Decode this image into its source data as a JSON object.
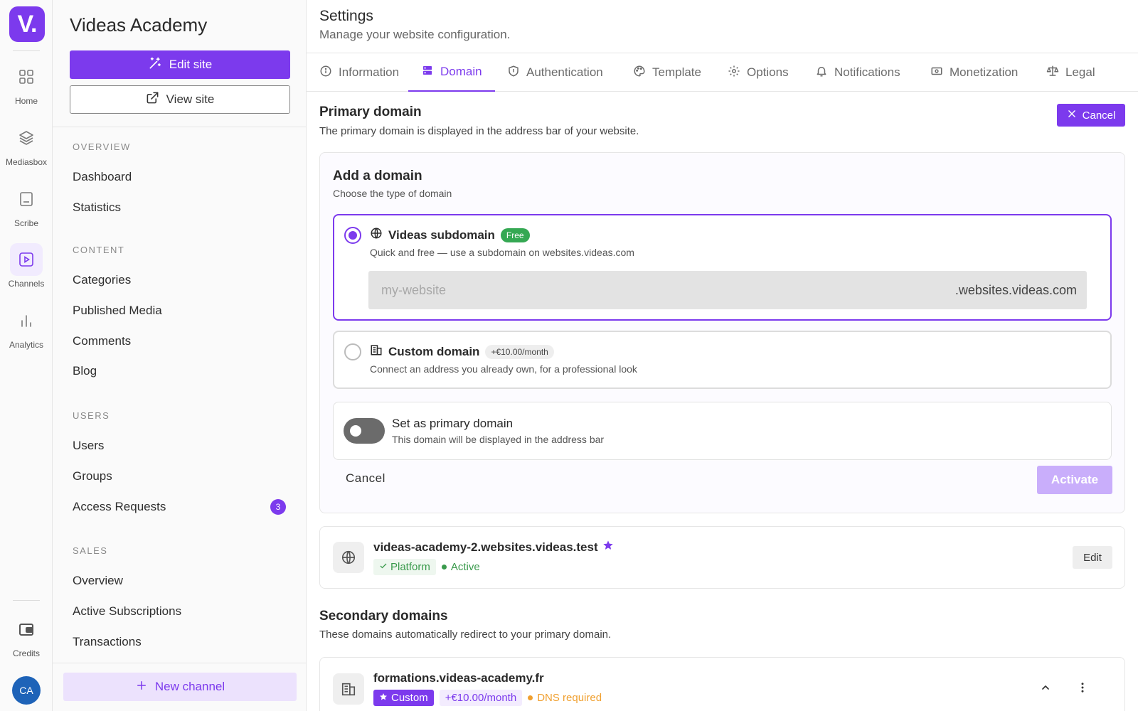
{
  "rail": {
    "logo": "V.",
    "items": [
      {
        "label": "Home",
        "icon": "grid-icon"
      },
      {
        "label": "Mediasbox",
        "icon": "layers-icon"
      },
      {
        "label": "Scribe",
        "icon": "document-icon"
      },
      {
        "label": "Channels",
        "icon": "play-icon",
        "active": true
      },
      {
        "label": "Analytics",
        "icon": "bar-chart-icon"
      }
    ],
    "credits_label": "Credits",
    "avatar_initials": "CA"
  },
  "sidebar": {
    "site_title": "Videas Academy",
    "edit_site_label": "Edit site",
    "view_site_label": "View site",
    "sections": [
      {
        "label": "OVERVIEW",
        "items": [
          {
            "label": "Dashboard"
          },
          {
            "label": "Statistics"
          }
        ]
      },
      {
        "label": "CONTENT",
        "items": [
          {
            "label": "Categories"
          },
          {
            "label": "Published Media"
          },
          {
            "label": "Comments"
          },
          {
            "label": "Blog"
          }
        ]
      },
      {
        "label": "USERS",
        "items": [
          {
            "label": "Users"
          },
          {
            "label": "Groups"
          },
          {
            "label": "Access Requests",
            "badge": "3"
          }
        ]
      },
      {
        "label": "SALES",
        "items": [
          {
            "label": "Overview"
          },
          {
            "label": "Active Subscriptions"
          },
          {
            "label": "Transactions"
          }
        ]
      }
    ],
    "new_channel_label": "New channel"
  },
  "header": {
    "title": "Settings",
    "subtitle": "Manage your website configuration."
  },
  "tabs": [
    {
      "label": "Information",
      "icon": "info-icon"
    },
    {
      "label": "Domain",
      "icon": "server-icon",
      "active": true
    },
    {
      "label": "Authentication",
      "icon": "shield-icon"
    },
    {
      "label": "Template",
      "icon": "palette-icon"
    },
    {
      "label": "Options",
      "icon": "gear-icon"
    },
    {
      "label": "Notifications",
      "icon": "bell-icon"
    },
    {
      "label": "Monetization",
      "icon": "money-icon"
    },
    {
      "label": "Legal",
      "icon": "scale-icon"
    }
  ],
  "primary": {
    "title": "Primary domain",
    "description": "The primary domain is displayed in the address bar of your website.",
    "cancel_label": "Cancel",
    "add": {
      "title": "Add a domain",
      "subtitle": "Choose the type of domain",
      "subdomain_option": {
        "title": "Videas subdomain",
        "badge": "Free",
        "description": "Quick and free — use a subdomain on websites.videas.com",
        "placeholder": "my-website",
        "suffix": ".websites.videas.com",
        "selected": true
      },
      "custom_option": {
        "title": "Custom domain",
        "badge": "+€10.00/month",
        "description": "Connect an address you already own, for a professional look",
        "selected": false
      },
      "toggle": {
        "title": "Set as primary domain",
        "description": "This domain will be displayed in the address bar",
        "on": false
      },
      "cancel_label": "Cancel",
      "activate_label": "Activate"
    },
    "current": {
      "name": "videas-academy-2.websites.videas.test",
      "tag": "Platform",
      "status": "Active",
      "edit_label": "Edit"
    }
  },
  "secondary": {
    "title": "Secondary domains",
    "description": "These domains automatically redirect to your primary domain.",
    "items": [
      {
        "name": "formations.videas-academy.fr",
        "tag": "Custom",
        "price": "+€10.00/month",
        "status": "DNS required"
      }
    ]
  },
  "colors": {
    "accent": "#7c3aed",
    "success": "#3a9a4c",
    "warning": "#f0a030"
  }
}
